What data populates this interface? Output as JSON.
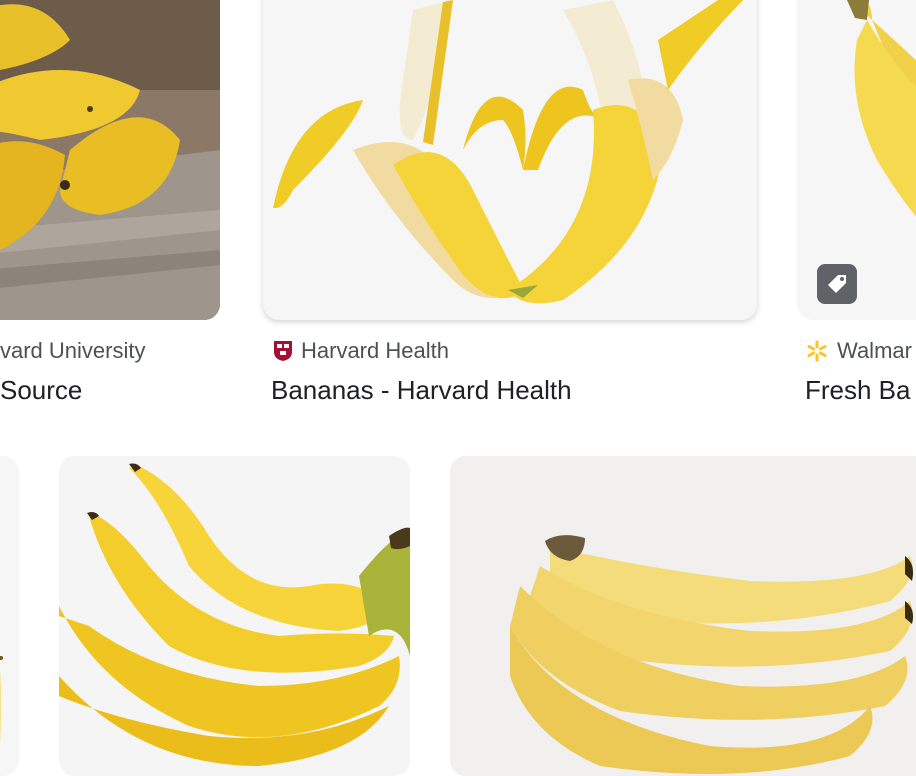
{
  "results": [
    {
      "source": "vard University",
      "title": "Source",
      "favicon": "none",
      "image": "banana-bunch-on-wood-photo"
    },
    {
      "source": "Harvard Health",
      "title": "Bananas - Harvard Health",
      "favicon": "harvard-shield-icon",
      "image": "two-peeled-bananas-heart-photo"
    },
    {
      "source": "Walmar",
      "title": "Fresh Ba",
      "favicon": "walmart-spark-icon",
      "image": "single-banana-photo",
      "badge": "shopping-tag-icon"
    },
    {
      "image": "partial-banana-photo"
    },
    {
      "image": "banana-bunch-white-background-photo"
    },
    {
      "image": "ripe-banana-bunch-photo"
    }
  ],
  "colors": {
    "banana_yellow": "#f5d33c",
    "brand_walmart": "#ffc220",
    "brand_harvard": "#a41034",
    "card_bg": "#f6f6f7"
  }
}
